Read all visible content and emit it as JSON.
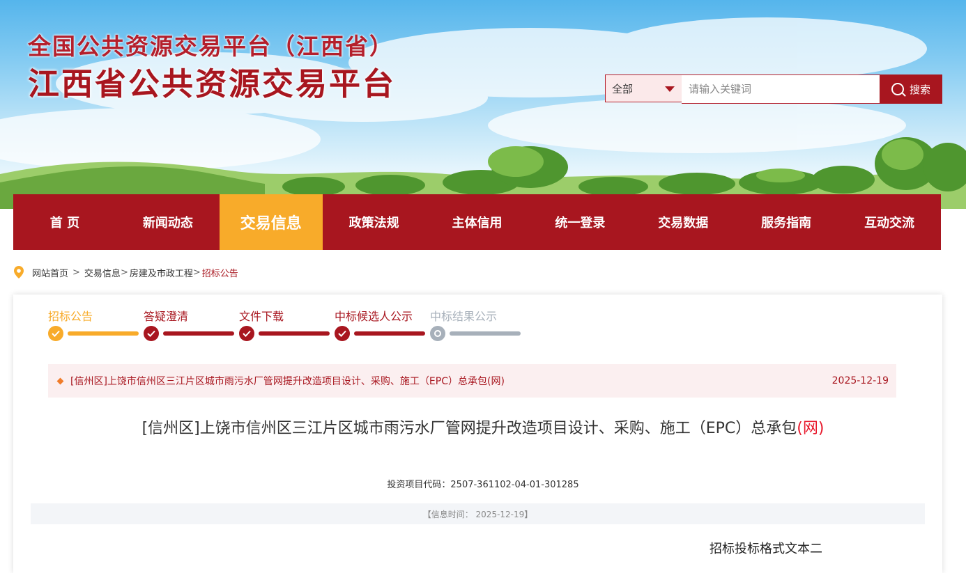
{
  "header": {
    "title_line1": "全国公共资源交易平台（江西省）",
    "title_line2": "江西省公共资源交易平台"
  },
  "search": {
    "scope_selected": "全部",
    "placeholder": "请输入关键词",
    "button_label": "搜索"
  },
  "nav": {
    "items": [
      {
        "label": "首 页"
      },
      {
        "label": "新闻动态"
      },
      {
        "label": "交易信息"
      },
      {
        "label": "政策法规"
      },
      {
        "label": "主体信用"
      },
      {
        "label": "统一登录"
      },
      {
        "label": "交易数据"
      },
      {
        "label": "服务指南"
      },
      {
        "label": "互动交流"
      }
    ],
    "active_index": 2
  },
  "breadcrumb": {
    "items": [
      "网站首页",
      "交易信息",
      "房建及市政工程",
      "招标公告"
    ]
  },
  "steps": [
    {
      "label": "招标公告",
      "state": "current"
    },
    {
      "label": "答疑澄清",
      "state": "done"
    },
    {
      "label": "文件下载",
      "state": "done"
    },
    {
      "label": "中标候选人公示",
      "state": "done"
    },
    {
      "label": "中标结果公示",
      "state": "pending"
    }
  ],
  "notice": {
    "title": "[信州区]上饶市信州区三江片区城市雨污水厂管网提升改造项目设计、采购、施工（EPC）总承包(网)",
    "date": "2025-12-19"
  },
  "article": {
    "title_main": "[信州区]上饶市信州区三江片区城市雨污水厂管网提升改造项目设计、采购、施工（EPC）总承包",
    "title_tag": "(网)",
    "project_code": "投资项目代码：2507-361102-04-01-301285",
    "info_time": "【信息时间： 2025-12-19】",
    "doc_subtitle": "招标投标格式文本二"
  },
  "colors": {
    "brand_red": "#a8161f",
    "accent_orange": "#f8ab2a",
    "pending_gray": "#a7b0ba"
  }
}
